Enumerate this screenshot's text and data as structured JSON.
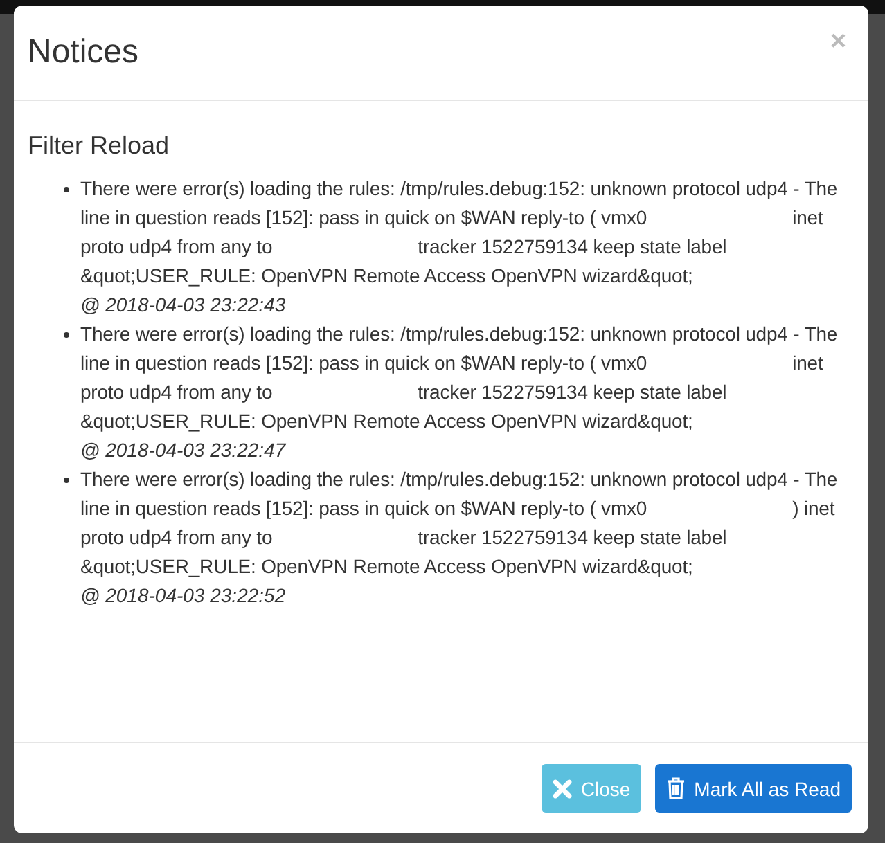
{
  "dialog": {
    "title": "Notices",
    "close_symbol": "×"
  },
  "section": {
    "title": "Filter Reload"
  },
  "notices": [
    {
      "segments": [
        "There were error(s) loading the rules: /tmp/rules.debug:152: unknown protocol udp4 - The line in question reads [152]: pass in quick on $WAN reply-to ( vmx0",
        "inet proto udp4 from any to",
        "tracker 1522759134 keep state label &quot;USER_RULE: OpenVPN Remote Access OpenVPN wizard&quot;"
      ],
      "time": "@ 2018-04-03 23:22:43"
    },
    {
      "segments": [
        "There were error(s) loading the rules: /tmp/rules.debug:152: unknown protocol udp4 - The line in question reads [152]: pass in quick on $WAN reply-to ( vmx0",
        "inet proto udp4 from any to",
        "tracker 1522759134 keep state label &quot;USER_RULE: OpenVPN Remote Access OpenVPN wizard&quot;"
      ],
      "time": "@ 2018-04-03 23:22:47"
    },
    {
      "segments": [
        "There were error(s) loading the rules: /tmp/rules.debug:152: unknown protocol udp4 - The line in question reads [152]: pass in quick on $WAN reply-to ( vmx0",
        ") inet proto udp4 from any to",
        "tracker 1522759134 keep state label &quot;USER_RULE: OpenVPN Remote Access OpenVPN wizard&quot;"
      ],
      "time": "@ 2018-04-03 23:22:52"
    }
  ],
  "buttons": [
    {
      "kind": "close",
      "label": "Close"
    },
    {
      "kind": "mark-read",
      "label": "Mark All as Read"
    }
  ]
}
